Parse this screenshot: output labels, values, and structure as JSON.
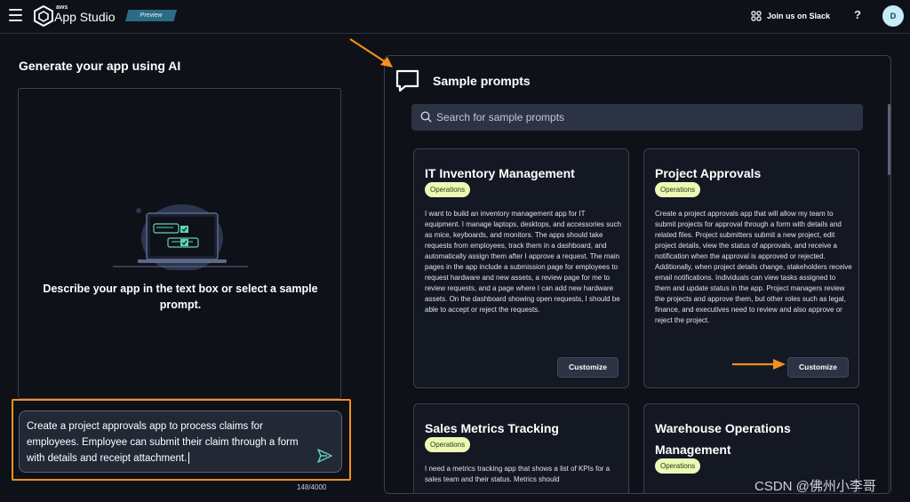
{
  "header": {
    "logo_aws": "aws",
    "logo_text": "App Studio",
    "badge": "Preview",
    "slack_label": "Join us on Slack",
    "help_symbol": "?",
    "avatar_initial": "D"
  },
  "left": {
    "title": "Generate your app using AI",
    "illustration_text": "Describe your app in the text box or select a sample prompt.",
    "prompt_text": "Create a project approvals app to process claims for employees. Employee can submit their claim through a form with details and receipt attachment.",
    "char_count": "148/4000"
  },
  "samples": {
    "title": "Sample prompts",
    "search_placeholder": "Search for sample prompts",
    "customize_label": "Customize",
    "cards": [
      {
        "title": "IT Inventory Management",
        "badge": "Operations",
        "description": "I want to build an inventory management app for IT equipment. I manage laptops, desktops, and accessories such as mice, keyboards, and monitors. The apps should take requests from employees, track them in a dashboard, and automatically assign them after I approve a request. The main pages in the app include a submission page for employees to request hardware and new assets, a review page for me to review requests, and a page where I can add new hardware assets. On the dashboard showing open requests, I should be able to accept or reject the requests."
      },
      {
        "title": "Project Approvals",
        "badge": "Operations",
        "description": "Create a project approvals app that will allow my team to submit projects for approval through a form with details and related files. Project submitters submit a new project, edit project details, view the status of approvals, and receive a notification when the approval is approved or rejected. Additionally, when project details change, stakeholders receive email notifications. Individuals can view tasks assigned to them and update status in the app. Project managers review the projects and approve them, but other roles such as legal, finance, and executives need to review and also approve or reject the project."
      },
      {
        "title": "Sales Metrics Tracking",
        "badge": "Operations",
        "description": "I need a metrics tracking app that shows a list of KPIs for a sales team and their status. Metrics should"
      },
      {
        "title": "Warehouse Operations Management",
        "badge": "Operations",
        "description": ""
      }
    ]
  },
  "watermark": "CSDN @佛州小李哥",
  "colors": {
    "background": "#0f1118",
    "accent_orange": "#f5901e",
    "badge_bg": "#edf8b6",
    "preview_badge": "#2a6c86",
    "send_icon": "#5fd4b8"
  }
}
